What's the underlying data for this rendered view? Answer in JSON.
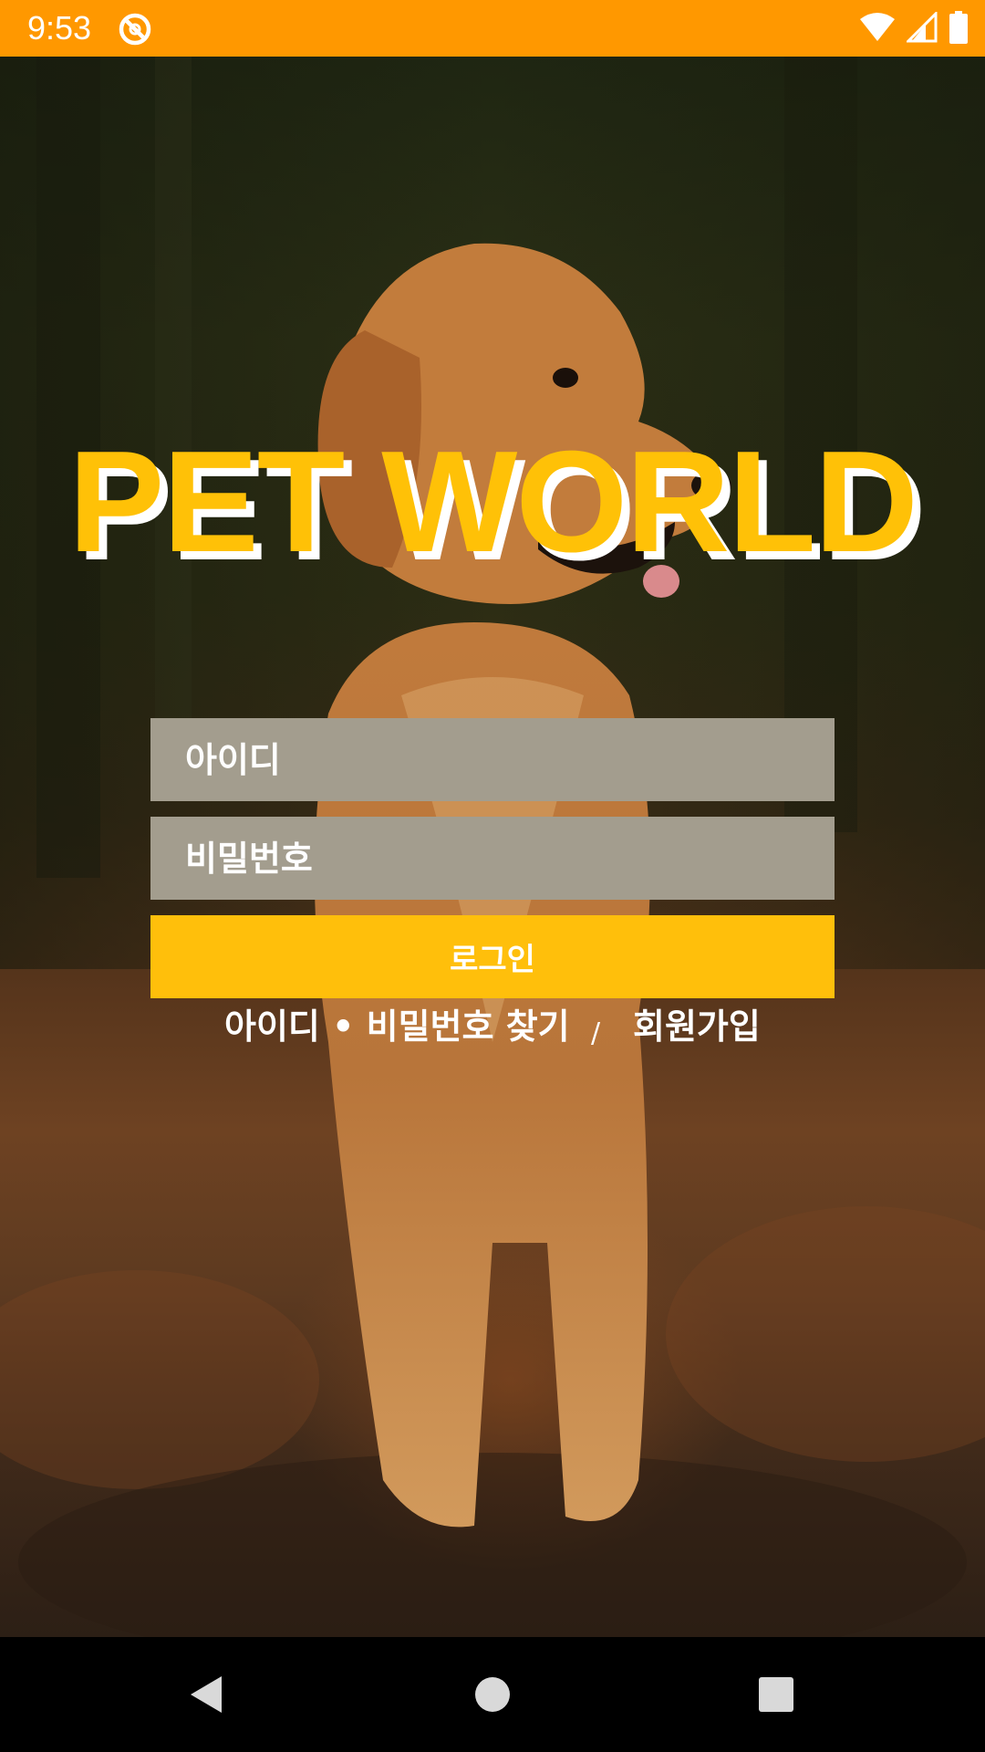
{
  "status_bar": {
    "time": "9:53",
    "background": "#ff9800",
    "icons": [
      "app-notification-icon",
      "wifi-icon",
      "cellular-signal-icon",
      "battery-icon"
    ]
  },
  "app": {
    "title": "PET WORLD",
    "title_color": "#ffc107",
    "title_shadow_color": "#ffffff"
  },
  "login_form": {
    "id_placeholder": "아이디",
    "password_placeholder": "비밀번호",
    "login_label": "로그인",
    "field_color": "#a39d8e",
    "button_color": "#ffbf0b"
  },
  "links": {
    "find_account": "아이디 • 비밀번호 찾기",
    "separator": "/",
    "sign_up": "회원가입"
  },
  "nav_bar": {
    "icons": [
      "back-icon",
      "home-icon",
      "recents-icon"
    ]
  }
}
